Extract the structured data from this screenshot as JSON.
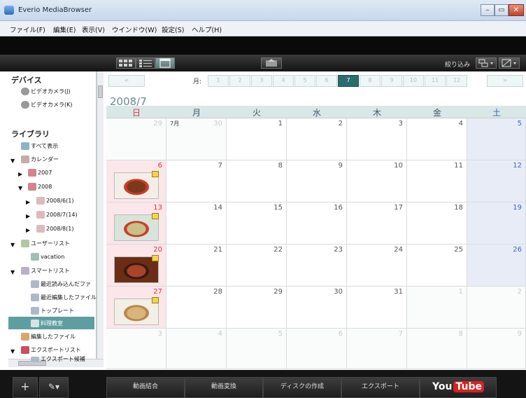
{
  "window": {
    "title": "Everio MediaBrowser",
    "controls": [
      "–",
      "▭",
      "✕"
    ]
  },
  "menu": [
    "ファイル(F)",
    "編集(E)",
    "表示(V)",
    "ウインドウ(W)",
    "設定(S)",
    "ヘルプ(H)"
  ],
  "toolbar": {
    "filter_label": "絞り込み"
  },
  "sidebar": {
    "devices_heading": "デバイス",
    "devices": [
      "ビデオカメラ(J)",
      "ビデオカメラ(K)"
    ],
    "library_heading": "ライブラリ",
    "items": [
      {
        "label": "すべて表示"
      },
      {
        "label": "カレンダー"
      },
      {
        "label": "2007"
      },
      {
        "label": "2008"
      },
      {
        "label": "2008/6(1)"
      },
      {
        "label": "2008/7(14)"
      },
      {
        "label": "2008/8(1)"
      },
      {
        "label": "ユーザーリスト"
      },
      {
        "label": "vacation"
      },
      {
        "label": "スマートリスト"
      },
      {
        "label": "最近読み込んだファ"
      },
      {
        "label": "最近編集したファイル"
      },
      {
        "label": "トップレート"
      },
      {
        "label": "料理教室"
      },
      {
        "label": "編集したファイル"
      },
      {
        "label": "エクスポートリスト"
      },
      {
        "label": "エクスポート候補"
      }
    ]
  },
  "month_nav": {
    "label": "月:",
    "months": [
      "1",
      "2",
      "3",
      "4",
      "5",
      "6",
      "7",
      "8",
      "9",
      "10",
      "11",
      "12"
    ],
    "selected": "7",
    "prev": "<",
    "next": ">"
  },
  "calendar": {
    "title": "2008/7",
    "day_names": [
      "日",
      "月",
      "火",
      "水",
      "木",
      "金",
      "土"
    ],
    "weeks": [
      [
        {
          "n": "29",
          "dim": true
        },
        {
          "n": "30",
          "dim": true,
          "sub": "7月"
        },
        {
          "n": "1"
        },
        {
          "n": "2"
        },
        {
          "n": "3"
        },
        {
          "n": "4"
        },
        {
          "n": "5"
        }
      ],
      [
        {
          "n": "6",
          "thumb": "food-plate"
        },
        {
          "n": "7"
        },
        {
          "n": "8"
        },
        {
          "n": "9"
        },
        {
          "n": "10"
        },
        {
          "n": "11"
        },
        {
          "n": "12"
        }
      ],
      [
        {
          "n": "13",
          "thumb": "soup-bowl"
        },
        {
          "n": "14"
        },
        {
          "n": "15"
        },
        {
          "n": "16"
        },
        {
          "n": "17"
        },
        {
          "n": "18"
        },
        {
          "n": "19"
        }
      ],
      [
        {
          "n": "20",
          "thumb": "grilled-dish"
        },
        {
          "n": "21"
        },
        {
          "n": "22"
        },
        {
          "n": "23"
        },
        {
          "n": "24"
        },
        {
          "n": "25"
        },
        {
          "n": "26"
        }
      ],
      [
        {
          "n": "27",
          "thumb": "bread"
        },
        {
          "n": "28"
        },
        {
          "n": "29"
        },
        {
          "n": "30"
        },
        {
          "n": "31"
        },
        {
          "n": "1",
          "dim": true
        },
        {
          "n": "2",
          "dim": true
        }
      ],
      [
        {
          "n": "3",
          "dim": true
        },
        {
          "n": "4",
          "dim": true
        },
        {
          "n": "5",
          "dim": true
        },
        {
          "n": "6",
          "dim": true
        },
        {
          "n": "7",
          "dim": true
        },
        {
          "n": "8",
          "dim": true
        },
        {
          "n": "9",
          "dim": true
        }
      ]
    ]
  },
  "bottom": {
    "add": "+",
    "tools": "✎▾",
    "buttons": [
      "動画結合",
      "動画変換",
      "ディスクの作成",
      "エクスポート"
    ],
    "youtube_you": "You",
    "youtube_tube": "Tube"
  },
  "colors": {
    "accent": "#2a6d6d",
    "selected": "#5f9ea0",
    "sunday": "#d2384a",
    "saturday": "#3f66b0",
    "sunday_bg": "#fbe6e9",
    "saturday_bg": "#e8ecf7"
  }
}
